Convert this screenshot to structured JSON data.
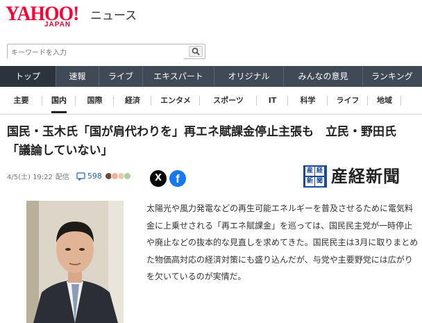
{
  "header": {
    "logo_text": "YAHOO!",
    "logo_sub": "JAPAN",
    "service": "ニュース"
  },
  "search": {
    "placeholder": "キーワードを入力",
    "button_icon": "search-icon"
  },
  "nav": {
    "items": [
      {
        "label": "トップ",
        "active": true
      },
      {
        "label": "速報"
      },
      {
        "label": "ライブ"
      },
      {
        "label": "エキスパート"
      },
      {
        "label": "オリジナル"
      },
      {
        "label": "みんなの意見"
      },
      {
        "label": "ランキング"
      }
    ]
  },
  "subnav": {
    "items": [
      {
        "label": "主要"
      },
      {
        "label": "国内",
        "active": true
      },
      {
        "label": "国際"
      },
      {
        "label": "経済"
      },
      {
        "label": "エンタメ"
      },
      {
        "label": "スポーツ"
      },
      {
        "label": "IT"
      },
      {
        "label": "科学"
      },
      {
        "label": "ライフ"
      },
      {
        "label": "地域"
      }
    ]
  },
  "article": {
    "title": "国民・玉木氏「国が肩代わりを」再エネ賦課金停止主張も　立民・野田氏「議論していない」",
    "datetime": "4/5(土) 19:22",
    "distribution": "配信",
    "comment_count": "598",
    "comment_icon": "comment-icon",
    "source_name": "産経新聞",
    "source_mark": [
      "産",
      "経",
      "新",
      "聞"
    ],
    "body": "太陽光や風力発電などの再生可能エネルギーを普及させるために電気料金に上乗せされる「再エネ賦課金」を巡っては、国民民主党が一時停止や廃止などの抜本的な見直しを求めてきた。国民民主は3月に取りまとめた物価高対応の経済対策にも盛り込んだが、与党や主要野党には広がりを欠いているのが実情だ。"
  },
  "share": {
    "x_label": "X",
    "facebook_label": "f"
  },
  "colors": {
    "brand": "#ff0033",
    "nav_bg": "#3f4a56",
    "link": "#2566cc"
  }
}
